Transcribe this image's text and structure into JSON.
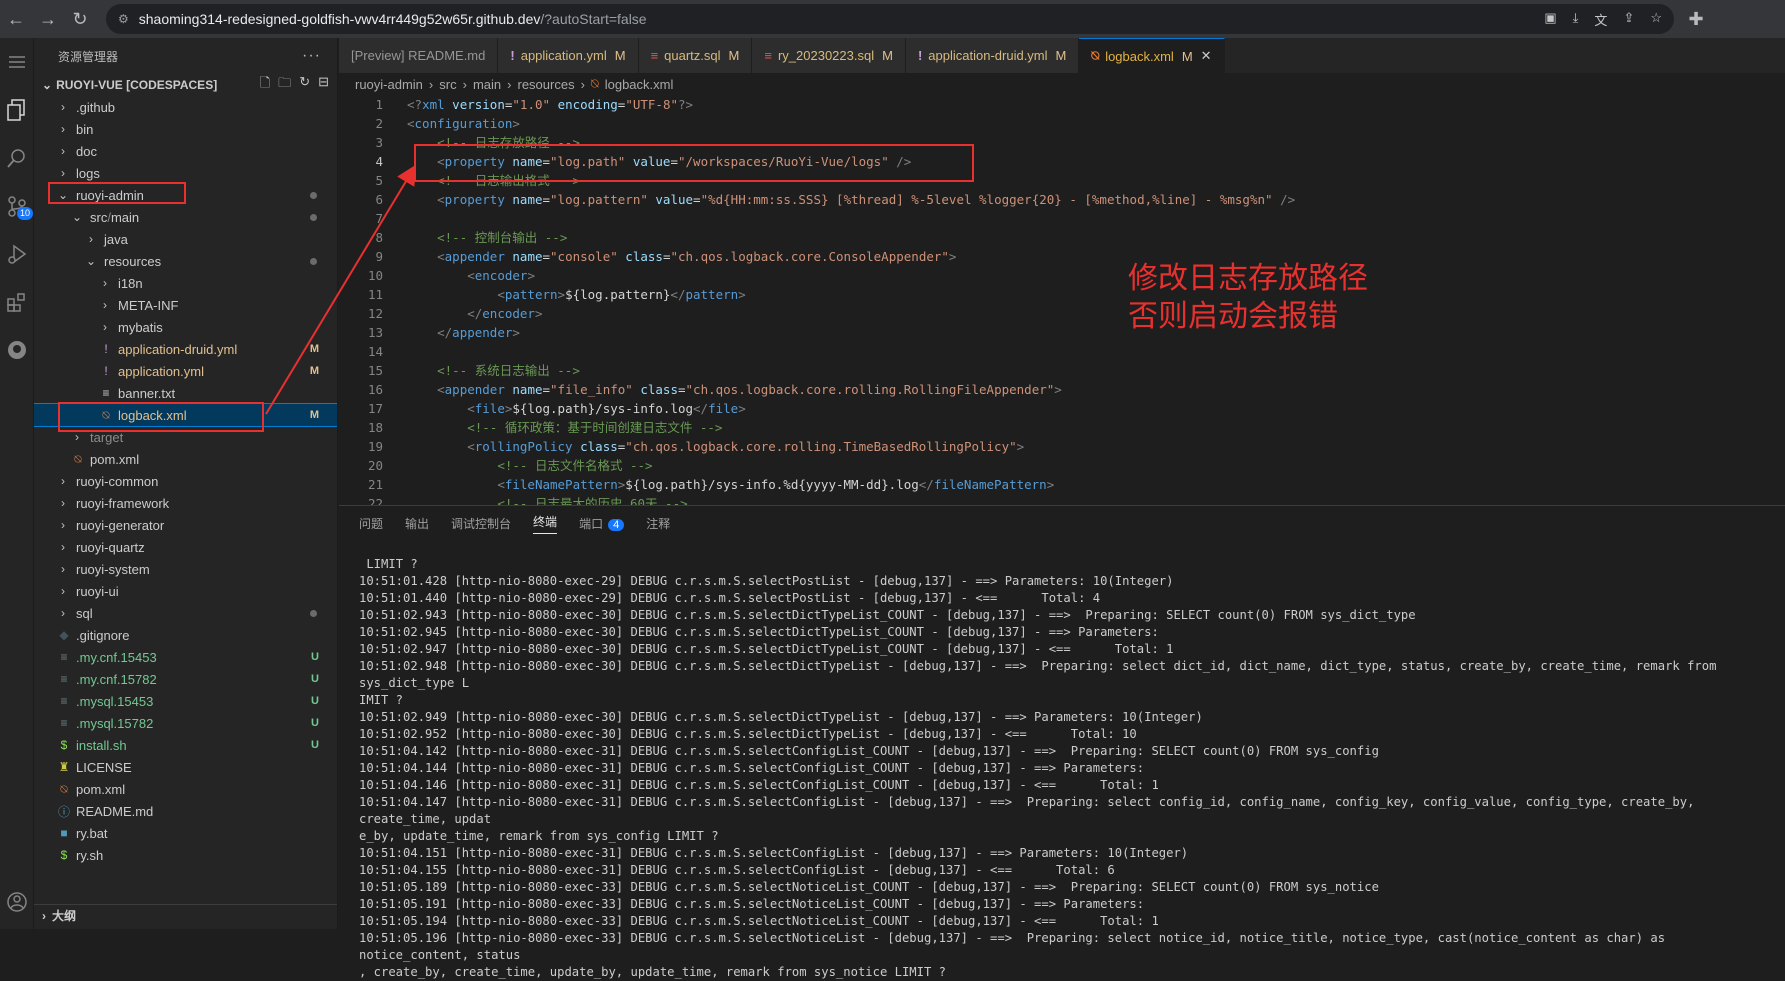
{
  "browser": {
    "url_host": "shaoming314-redesigned-goldfish-vwv4rr449g52w65r.github.dev",
    "url_path": "/?autoStart=false"
  },
  "activity_bar": {
    "scm_badge": "10"
  },
  "sidebar": {
    "title": "资源管理器",
    "more": "···",
    "root": "RUOYI-VUE [CODESPACES]",
    "items": [
      {
        "label": ".github",
        "chev": "›"
      },
      {
        "label": "bin",
        "chev": "›"
      },
      {
        "label": "doc",
        "chev": "›"
      },
      {
        "label": "logs",
        "chev": "›"
      },
      {
        "label": "ruoyi-admin",
        "chev": "⌄"
      },
      {
        "label": "src",
        "chev": "⌄",
        "label2": "main"
      },
      {
        "label": "java",
        "chev": "›"
      },
      {
        "label": "resources",
        "chev": "⌄"
      },
      {
        "label": "i18n",
        "chev": "›"
      },
      {
        "label": "META-INF",
        "chev": "›"
      },
      {
        "label": "mybatis",
        "chev": "›"
      },
      {
        "label": "application-druid.yml",
        "status": "M"
      },
      {
        "label": "application.yml",
        "status": "M"
      },
      {
        "label": "banner.txt"
      },
      {
        "label": "logback.xml",
        "status": "M"
      },
      {
        "label": "target",
        "chev": "›"
      },
      {
        "label": "pom.xml"
      },
      {
        "label": "ruoyi-common",
        "chev": "›"
      },
      {
        "label": "ruoyi-framework",
        "chev": "›"
      },
      {
        "label": "ruoyi-generator",
        "chev": "›"
      },
      {
        "label": "ruoyi-quartz",
        "chev": "›"
      },
      {
        "label": "ruoyi-system",
        "chev": "›"
      },
      {
        "label": "ruoyi-ui",
        "chev": "›"
      },
      {
        "label": "sql",
        "chev": "›"
      },
      {
        "label": ".gitignore"
      },
      {
        "label": ".my.cnf.15453",
        "status": "U"
      },
      {
        "label": ".my.cnf.15782",
        "status": "U"
      },
      {
        "label": ".mysql.15453",
        "status": "U"
      },
      {
        "label": ".mysql.15782",
        "status": "U"
      },
      {
        "label": "install.sh",
        "status": "U"
      },
      {
        "label": "LICENSE"
      },
      {
        "label": "pom.xml"
      },
      {
        "label": "README.md"
      },
      {
        "label": "ry.bat"
      },
      {
        "label": "ry.sh"
      }
    ],
    "outline": "大纲"
  },
  "tabs": [
    {
      "label": "[Preview] README.md",
      "icon": "",
      "mod": ""
    },
    {
      "label": "application.yml",
      "icon": "!",
      "mod": "M"
    },
    {
      "label": "quartz.sql",
      "icon": "≡",
      "mod": "M"
    },
    {
      "label": "ry_20230223.sql",
      "icon": "≡",
      "mod": "M"
    },
    {
      "label": "application-druid.yml",
      "icon": "!",
      "mod": "M"
    },
    {
      "label": "logback.xml",
      "icon": "⍉",
      "mod": "M",
      "close": "✕"
    }
  ],
  "breadcrumb": [
    "ruoyi-admin",
    "src",
    "main",
    "resources",
    "logback.xml"
  ],
  "editor": {
    "lines": [
      [
        [
          "t-brk",
          "<?"
        ],
        [
          "t-tag",
          "xml"
        ],
        [
          "",
          "​ "
        ],
        [
          "t-att",
          "version"
        ],
        [
          "",
          "="
        ],
        [
          "t-val",
          "\"1.0\""
        ],
        [
          "",
          "​ "
        ],
        [
          "t-att",
          "encoding"
        ],
        [
          "",
          "="
        ],
        [
          "t-val",
          "\"UTF-8\""
        ],
        [
          "t-brk",
          "?>"
        ]
      ],
      [
        [
          "t-brk",
          "<"
        ],
        [
          "t-tag",
          "configuration"
        ],
        [
          "t-brk",
          ">"
        ]
      ],
      [
        [
          "",
          "    "
        ],
        [
          "t-com",
          "<!-- 日志存放路径 -->"
        ]
      ],
      [
        [
          "",
          "    "
        ],
        [
          "t-brk",
          "<"
        ],
        [
          "t-tag",
          "property"
        ],
        [
          "",
          "​ "
        ],
        [
          "t-att",
          "name"
        ],
        [
          "",
          "="
        ],
        [
          "t-val",
          "\"log.path\""
        ],
        [
          "",
          "​ "
        ],
        [
          "t-att",
          "value"
        ],
        [
          "",
          "="
        ],
        [
          "t-val",
          "\"/workspaces/RuoYi-Vue/logs\""
        ],
        [
          "",
          "​ "
        ],
        [
          "t-brk",
          "/>"
        ]
      ],
      [
        [
          "",
          "    "
        ],
        [
          "t-com",
          "<!-- 日志输出格式 -->"
        ]
      ],
      [
        [
          "",
          "    "
        ],
        [
          "t-brk",
          "<"
        ],
        [
          "t-tag",
          "property"
        ],
        [
          "",
          "​ "
        ],
        [
          "t-att",
          "name"
        ],
        [
          "",
          "="
        ],
        [
          "t-val",
          "\"log.pattern\""
        ],
        [
          "",
          "​ "
        ],
        [
          "t-att",
          "value"
        ],
        [
          "",
          "="
        ],
        [
          "t-val",
          "\"%d{HH:mm:ss.SSS} [%thread] %-5level %logger{20} - [%method,%line] - %msg%n\""
        ],
        [
          "",
          "​ "
        ],
        [
          "t-brk",
          "/>"
        ]
      ],
      [
        [
          "",
          ""
        ]
      ],
      [
        [
          "",
          "    "
        ],
        [
          "t-com",
          "<!-- 控制台输出 -->"
        ]
      ],
      [
        [
          "",
          "    "
        ],
        [
          "t-brk",
          "<"
        ],
        [
          "t-tag",
          "appender"
        ],
        [
          "",
          "​ "
        ],
        [
          "t-att",
          "name"
        ],
        [
          "",
          "="
        ],
        [
          "t-val",
          "\"console\""
        ],
        [
          "",
          "​ "
        ],
        [
          "t-att",
          "class"
        ],
        [
          "",
          "="
        ],
        [
          "t-val",
          "\"ch.qos.logback.core.ConsoleAppender\""
        ],
        [
          "t-brk",
          ">"
        ]
      ],
      [
        [
          "",
          "        "
        ],
        [
          "t-brk",
          "<"
        ],
        [
          "t-tag",
          "encoder"
        ],
        [
          "t-brk",
          ">"
        ]
      ],
      [
        [
          "",
          "            "
        ],
        [
          "t-brk",
          "<"
        ],
        [
          "t-tag",
          "pattern"
        ],
        [
          "t-brk",
          ">"
        ],
        [
          "",
          "${log.pattern}"
        ],
        [
          "t-brk",
          "</"
        ],
        [
          "t-tag",
          "pattern"
        ],
        [
          "t-brk",
          ">"
        ]
      ],
      [
        [
          "",
          "        "
        ],
        [
          "t-brk",
          "</"
        ],
        [
          "t-tag",
          "encoder"
        ],
        [
          "t-brk",
          ">"
        ]
      ],
      [
        [
          "",
          "    "
        ],
        [
          "t-brk",
          "</"
        ],
        [
          "t-tag",
          "appender"
        ],
        [
          "t-brk",
          ">"
        ]
      ],
      [
        [
          "",
          ""
        ]
      ],
      [
        [
          "",
          "    "
        ],
        [
          "t-com",
          "<!-- 系统日志输出 -->"
        ]
      ],
      [
        [
          "",
          "    "
        ],
        [
          "t-brk",
          "<"
        ],
        [
          "t-tag",
          "appender"
        ],
        [
          "",
          "​ "
        ],
        [
          "t-att",
          "name"
        ],
        [
          "",
          "="
        ],
        [
          "t-val",
          "\"file_info\""
        ],
        [
          "",
          "​ "
        ],
        [
          "t-att",
          "class"
        ],
        [
          "",
          "="
        ],
        [
          "t-val",
          "\"ch.qos.logback.core.rolling.RollingFileAppender\""
        ],
        [
          "t-brk",
          ">"
        ]
      ],
      [
        [
          "",
          "        "
        ],
        [
          "t-brk",
          "<"
        ],
        [
          "t-tag",
          "file"
        ],
        [
          "t-brk",
          ">"
        ],
        [
          "",
          "${log.path}/sys-info.log"
        ],
        [
          "t-brk",
          "</"
        ],
        [
          "t-tag",
          "file"
        ],
        [
          "t-brk",
          ">"
        ]
      ],
      [
        [
          "",
          "        "
        ],
        [
          "t-com",
          "<!-- 循环政策：基于时间创建日志文件 -->"
        ]
      ],
      [
        [
          "",
          "        "
        ],
        [
          "t-brk",
          "<"
        ],
        [
          "t-tag",
          "rollingPolicy"
        ],
        [
          "",
          "​ "
        ],
        [
          "t-att",
          "class"
        ],
        [
          "",
          "="
        ],
        [
          "t-val",
          "\"ch.qos.logback.core.rolling.TimeBasedRollingPolicy\""
        ],
        [
          "t-brk",
          ">"
        ]
      ],
      [
        [
          "",
          "            "
        ],
        [
          "t-com",
          "<!-- 日志文件名格式 -->"
        ]
      ],
      [
        [
          "",
          "            "
        ],
        [
          "t-brk",
          "<"
        ],
        [
          "t-tag",
          "fileNamePattern"
        ],
        [
          "t-brk",
          ">"
        ],
        [
          "",
          "${log.path}/sys-info.%d{yyyy-MM-dd}.log"
        ],
        [
          "t-brk",
          "</"
        ],
        [
          "t-tag",
          "fileNamePattern"
        ],
        [
          "t-brk",
          ">"
        ]
      ],
      [
        [
          "",
          "            "
        ],
        [
          "t-com",
          "<!-- 日志最大的历史 60天 -->"
        ]
      ]
    ]
  },
  "annotation": "修改日志存放路径\n否则启动会报错",
  "panel": {
    "tabs": [
      "问题",
      "输出",
      "调试控制台",
      "终端",
      "端口",
      "注释"
    ],
    "ports_badge": "4",
    "terminal": " LIMIT ?\n10:51:01.428 [http-nio-8080-exec-29] DEBUG c.r.s.m.S.selectPostList - [debug,137] - ==> Parameters: 10(Integer)\n10:51:01.440 [http-nio-8080-exec-29] DEBUG c.r.s.m.S.selectPostList - [debug,137] - <==      Total: 4\n10:51:02.943 [http-nio-8080-exec-30] DEBUG c.r.s.m.S.selectDictTypeList_COUNT - [debug,137] - ==>  Preparing: SELECT count(0) FROM sys_dict_type\n10:51:02.945 [http-nio-8080-exec-30] DEBUG c.r.s.m.S.selectDictTypeList_COUNT - [debug,137] - ==> Parameters: \n10:51:02.947 [http-nio-8080-exec-30] DEBUG c.r.s.m.S.selectDictTypeList_COUNT - [debug,137] - <==      Total: 1\n10:51:02.948 [http-nio-8080-exec-30] DEBUG c.r.s.m.S.selectDictTypeList - [debug,137] - ==>  Preparing: select dict_id, dict_name, dict_type, status, create_by, create_time, remark from sys_dict_type L\nIMIT ?\n10:51:02.949 [http-nio-8080-exec-30] DEBUG c.r.s.m.S.selectDictTypeList - [debug,137] - ==> Parameters: 10(Integer)\n10:51:02.952 [http-nio-8080-exec-30] DEBUG c.r.s.m.S.selectDictTypeList - [debug,137] - <==      Total: 10\n10:51:04.142 [http-nio-8080-exec-31] DEBUG c.r.s.m.S.selectConfigList_COUNT - [debug,137] - ==>  Preparing: SELECT count(0) FROM sys_config\n10:51:04.144 [http-nio-8080-exec-31] DEBUG c.r.s.m.S.selectConfigList_COUNT - [debug,137] - ==> Parameters: \n10:51:04.146 [http-nio-8080-exec-31] DEBUG c.r.s.m.S.selectConfigList_COUNT - [debug,137] - <==      Total: 1\n10:51:04.147 [http-nio-8080-exec-31] DEBUG c.r.s.m.S.selectConfigList - [debug,137] - ==>  Preparing: select config_id, config_name, config_key, config_value, config_type, create_by, create_time, updat\ne_by, update_time, remark from sys_config LIMIT ?\n10:51:04.151 [http-nio-8080-exec-31] DEBUG c.r.s.m.S.selectConfigList - [debug,137] - ==> Parameters: 10(Integer)\n10:51:04.155 [http-nio-8080-exec-31] DEBUG c.r.s.m.S.selectConfigList - [debug,137] - <==      Total: 6\n10:51:05.189 [http-nio-8080-exec-33] DEBUG c.r.s.m.S.selectNoticeList_COUNT - [debug,137] - ==>  Preparing: SELECT count(0) FROM sys_notice\n10:51:05.191 [http-nio-8080-exec-33] DEBUG c.r.s.m.S.selectNoticeList_COUNT - [debug,137] - ==> Parameters: \n10:51:05.194 [http-nio-8080-exec-33] DEBUG c.r.s.m.S.selectNoticeList_COUNT - [debug,137] - <==      Total: 1\n10:51:05.196 [http-nio-8080-exec-33] DEBUG c.r.s.m.S.selectNoticeList - [debug,137] - ==>  Preparing: select notice_id, notice_title, notice_type, cast(notice_content as char) as notice_content, status\n, create_by, create_time, update_by, update_time, remark from sys_notice LIMIT ?"
  },
  "colors": {
    "accent": "#0078d4",
    "annotation_red": "#e8312f",
    "modified": "#e2c08d",
    "untracked": "#73c991"
  }
}
